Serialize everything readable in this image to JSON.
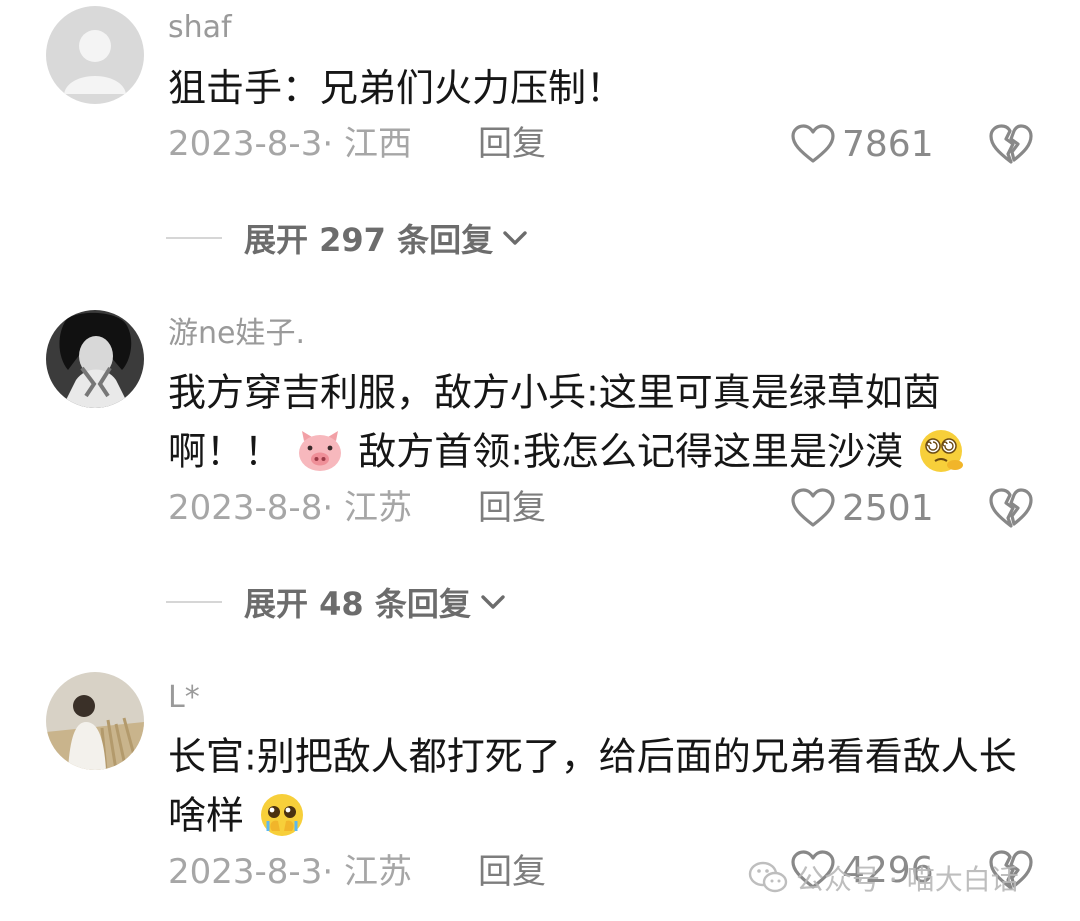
{
  "comments": [
    {
      "username": "shaf",
      "text": "狙击手：兄弟们火力压制！",
      "meta": "2023-8-3· 江西",
      "reply_label": "回复",
      "likes": "7861",
      "expand_label": "展开 297 条回复"
    },
    {
      "username": "游ne娃子.",
      "text_part1": "我方穿吉利服，敌方小兵:这里可真是绿草如茵啊！！",
      "text_part2": "敌方首领:我怎么记得这里是沙漠",
      "meta": "2023-8-8· 江苏",
      "reply_label": "回复",
      "likes": "2501",
      "expand_label": "展开 48 条回复"
    },
    {
      "username": "L*",
      "text": "长官:别把敌人都打死了，给后面的兄弟看看敌人长啥样",
      "meta": "2023-8-3· 江苏",
      "reply_label": "回复",
      "likes": "4296"
    }
  ],
  "watermark": "公众号 · 喵大白话",
  "icons": {
    "like": "heart-outline-icon",
    "dislike": "broken-heart-icon",
    "expand": "chevron-down-icon"
  },
  "colors": {
    "text": "#161616",
    "muted": "#a6a6a6",
    "reply": "#7d7d7d"
  }
}
